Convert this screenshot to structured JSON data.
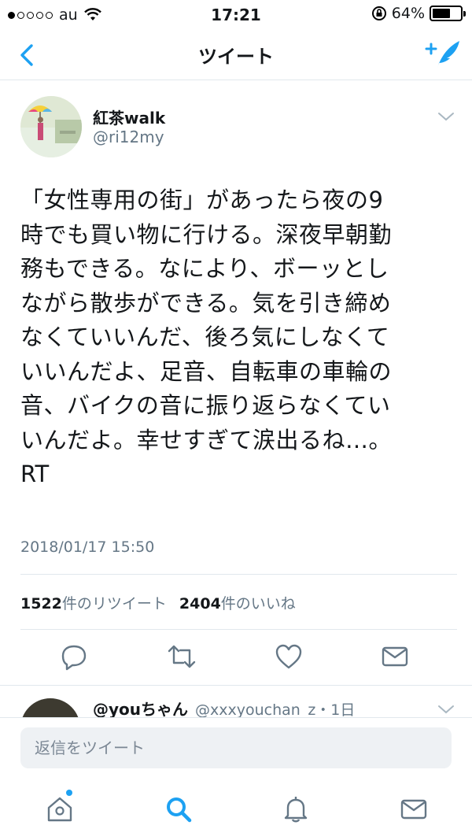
{
  "status_bar": {
    "carrier": "au",
    "time": "17:21",
    "battery": "64%",
    "battery_level": 0.64
  },
  "nav": {
    "title": "ツイート"
  },
  "tweet": {
    "display_name": "紅茶walk",
    "handle": "@ri12my",
    "text": "「女性専用の街」があったら夜の9\n時でも買い物に行ける。深夜早朝勤\n務もできる。なにより、ボーッとし\nながら散歩ができる。気を引き締め\nなくていいんだ、後ろ気にしなくて\nいいんだよ、足音、自転車の車輪の\n音、バイクの音に振り返らなくてい\nいんだよ。幸せすぎて涙出るね…。\nRT",
    "date": "2018/01/17 15:50",
    "retweet_count": "1522",
    "retweet_label": "件のリツイート",
    "like_count": "2404",
    "like_label": "件のいいね"
  },
  "reply": {
    "name": "@youちゃん",
    "meta": "@xxxyouchan_z・1日"
  },
  "composer": {
    "placeholder": "返信をツイート"
  },
  "colors": {
    "accent": "#1da1f2",
    "icon_gray": "#657786",
    "text": "#14171a"
  },
  "icons": [
    "back-chevron-icon",
    "compose-icon",
    "chevron-down-icon",
    "reply-icon",
    "retweet-icon",
    "like-icon",
    "dm-icon",
    "home-icon",
    "search-icon",
    "notifications-icon",
    "messages-icon"
  ]
}
